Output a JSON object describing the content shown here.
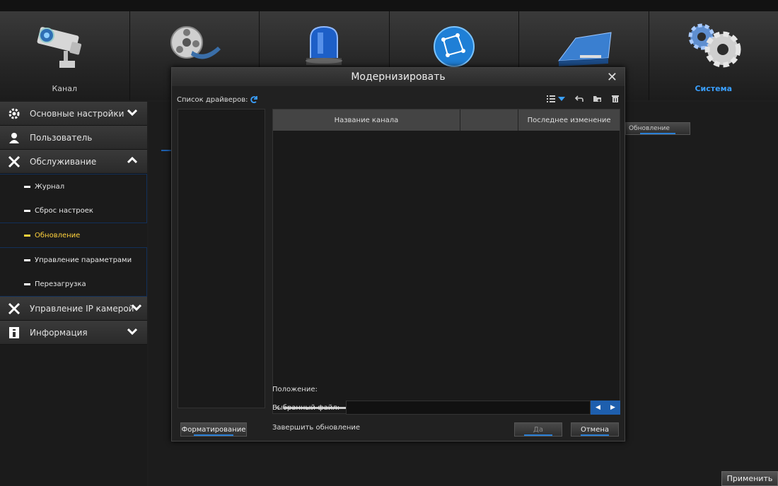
{
  "nav": {
    "tabs": [
      {
        "label": "Канал",
        "icon": "camera-icon",
        "active": false
      },
      {
        "label": "",
        "icon": "film-reel-icon",
        "active": false
      },
      {
        "label": "",
        "icon": "alarm-siren-icon",
        "active": false
      },
      {
        "label": "",
        "icon": "network-globe-icon",
        "active": false
      },
      {
        "label": "",
        "icon": "hard-drive-icon",
        "active": false
      },
      {
        "label": "Система",
        "icon": "gears-icon",
        "active": true
      }
    ]
  },
  "sidebar": {
    "basic_settings": "Основные настройки",
    "user": "Пользователь",
    "maintenance": "Обслуживание",
    "sub_items": [
      "Журнал",
      "Сброс настроек",
      "Обновление",
      "Управление параметрами",
      "Перезагрузка"
    ],
    "ip_camera": "Управление IP камерой",
    "info": "Информация"
  },
  "background": {
    "update_tab": "Обновление",
    "apply": "Применить"
  },
  "modal": {
    "title": "Модернизировать",
    "close": "✕",
    "driver_list_label": "Список драйверов:",
    "columns": [
      "Название канала",
      "",
      "Последнее изменение"
    ],
    "position_label": "Положение:",
    "selected_file_label": "Выбранный файл:",
    "selected_file_value": "",
    "format_button": "Форматирование",
    "finish_label": "Завершить обновление",
    "yes_button": "Да",
    "cancel_button": "Отмена"
  },
  "colors": {
    "accent": "#2a7fd6",
    "active_item": "#ffd23c",
    "active_tab": "#3aa0ff"
  }
}
